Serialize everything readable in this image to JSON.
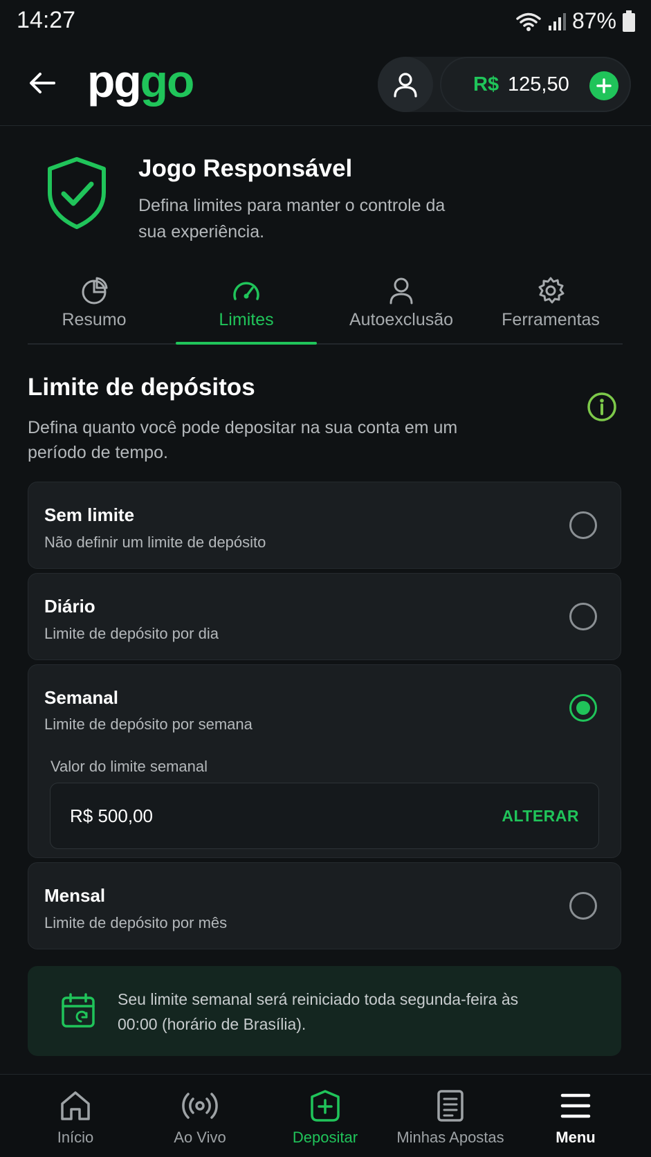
{
  "status_bar": {
    "time": "14:27",
    "battery": "87%"
  },
  "header": {
    "logo_pg": "pg",
    "logo_go": "go",
    "balance_currency": "R$",
    "balance_value": "125,50"
  },
  "hero": {
    "title": "Jogo Responsável",
    "description": "Defina limites para manter o controle da sua experiência."
  },
  "tabs": [
    {
      "label": "Resumo",
      "icon": "pie-chart-icon",
      "active": false
    },
    {
      "label": "Limites",
      "icon": "speedometer-icon",
      "active": true
    },
    {
      "label": "Autoexclusão",
      "icon": "person-icon",
      "active": false
    },
    {
      "label": "Ferramentas",
      "icon": "gear-icon",
      "active": false
    }
  ],
  "section": {
    "title": "Limite de depósitos",
    "description": "Defina quanto você pode depositar na sua conta em um período de tempo."
  },
  "options": [
    {
      "title": "Sem limite",
      "subtitle": "Não definir um limite de depósito",
      "selected": false
    },
    {
      "title": "Diário",
      "subtitle": "Limite de depósito por dia",
      "selected": false
    },
    {
      "title": "Semanal",
      "subtitle": "Limite de depósito por semana",
      "selected": true
    },
    {
      "title": "Mensal",
      "subtitle": "Limite de depósito por mês",
      "selected": false
    }
  ],
  "weekly_limit": {
    "label": "Valor do limite semanal",
    "value": "R$ 500,00",
    "action": "ALTERAR"
  },
  "notice": {
    "text": "Seu limite semanal será reiniciado toda segunda-feira às 00:00 (horário de Brasília)."
  },
  "bottom_nav": [
    {
      "label": "Início",
      "icon": "home-icon"
    },
    {
      "label": "Ao Vivo",
      "icon": "live-broadcast-icon"
    },
    {
      "label": "Depositar",
      "icon": "deposit-plus-icon"
    },
    {
      "label": "Minhas Apostas",
      "icon": "bet-slip-icon"
    },
    {
      "label": "Menu",
      "icon": "menu-icon"
    }
  ],
  "colors": {
    "accent": "#20c45a",
    "background": "#0f1214",
    "card": "#1a1e21"
  }
}
